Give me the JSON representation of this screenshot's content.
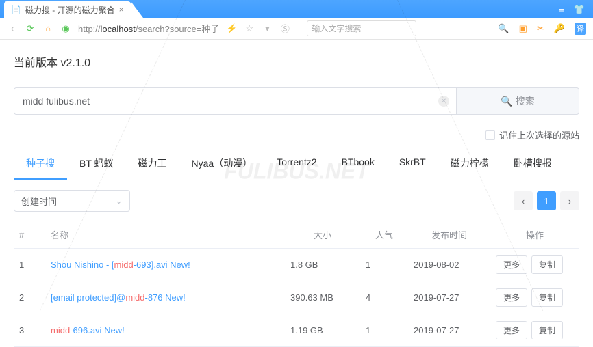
{
  "browser": {
    "tab_title": "磁力搜 - 开源的磁力聚合",
    "url_host": "localhost",
    "url_prefix": "http://",
    "url_path": "/search?source=种子",
    "addr_placeholder": "输入文字搜索"
  },
  "page": {
    "version_label": "当前版本 v2.1.0",
    "search_value": "midd fulibus.net",
    "search_btn": "搜索",
    "remember_label": "记住上次选择的源站",
    "sort_value": "创建时间",
    "pagination": {
      "prev": "‹",
      "current": "1",
      "next": "›"
    }
  },
  "tabs": [
    "种子搜",
    "BT 蚂蚁",
    "磁力王",
    "Nyaa（动漫）",
    "Torrentz2",
    "BTbook",
    "SkrBT",
    "磁力柠檬",
    "卧槽搜报"
  ],
  "active_tab": 0,
  "table": {
    "headers": {
      "idx": "#",
      "name": "名称",
      "size": "大小",
      "hot": "人气",
      "date": "发布时间",
      "ops": "操作"
    },
    "more_btn": "更多",
    "copy_btn": "复制",
    "rows": [
      {
        "idx": "1",
        "name_parts": [
          "Shou Nishino - [",
          "midd",
          "-693].avi ",
          "New!"
        ],
        "size": "1.8 GB",
        "hot": "1",
        "date": "2019-08-02"
      },
      {
        "idx": "2",
        "name_parts": [
          "[email protected]@",
          "midd",
          "-876 ",
          "New!"
        ],
        "size": "390.63 MB",
        "hot": "4",
        "date": "2019-07-27"
      },
      {
        "idx": "3",
        "name_parts": [
          "",
          "midd",
          "-696.avi ",
          "New!"
        ],
        "size": "1.19 GB",
        "hot": "1",
        "date": "2019-07-27"
      }
    ]
  },
  "watermark": "FULIBUS.NET"
}
